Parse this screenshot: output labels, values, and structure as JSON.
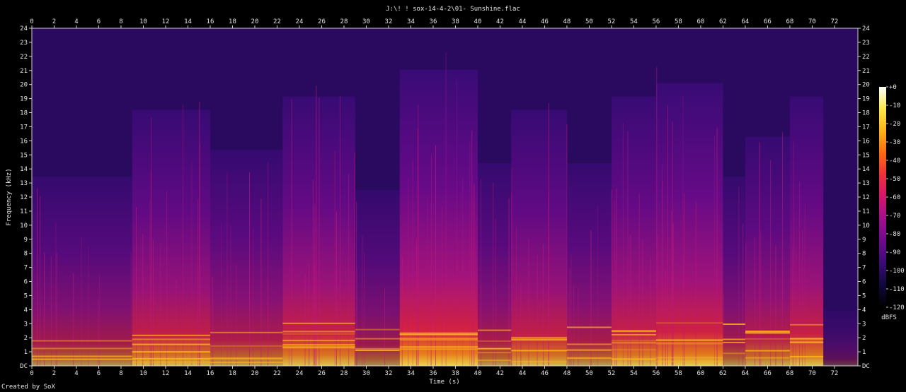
{
  "chart_data": {
    "type": "heatmap",
    "title": "J:\\! ! sox-14-4-2\\01- Sunshine.flac",
    "xlabel": "Time (s)",
    "ylabel": "Frequency (kHz)",
    "xlim": [
      0,
      74.1
    ],
    "ylim": [
      0,
      24
    ],
    "x_ticks": [
      "0",
      "2",
      "4",
      "6",
      "8",
      "10",
      "12",
      "14",
      "16",
      "18",
      "20",
      "22",
      "24",
      "26",
      "28",
      "30",
      "32",
      "34",
      "36",
      "38",
      "40",
      "42",
      "44",
      "46",
      "48",
      "50",
      "52",
      "54",
      "56",
      "58",
      "60",
      "62",
      "64",
      "66",
      "68",
      "70",
      "72"
    ],
    "y_ticks": [
      "DC",
      "1",
      "2",
      "3",
      "4",
      "5",
      "6",
      "7",
      "8",
      "9",
      "10",
      "11",
      "12",
      "13",
      "14",
      "15",
      "16",
      "17",
      "18",
      "19",
      "20",
      "21",
      "22",
      "23",
      "24"
    ],
    "colorbar": {
      "label": "dBFS",
      "ticks": [
        "+0",
        "-10",
        "-20",
        "-30",
        "-40",
        "-50",
        "-60",
        "-70",
        "-80",
        "-90",
        "-100",
        "-110",
        "-120"
      ],
      "range": [
        -120,
        0
      ],
      "colors": [
        "#000000",
        "#10083a",
        "#3a0b78",
        "#6e0a8c",
        "#a00f8e",
        "#d2166e",
        "#ef2f3b",
        "#fb6a10",
        "#fdb21a",
        "#fde84a",
        "#ffffff"
      ]
    },
    "segments_s": [
      [
        0,
        9,
        0.55
      ],
      [
        9,
        16,
        0.8
      ],
      [
        16,
        22.5,
        0.65
      ],
      [
        22.5,
        29,
        0.85
      ],
      [
        29,
        33,
        0.5
      ],
      [
        33,
        40,
        0.95
      ],
      [
        40,
        43,
        0.6
      ],
      [
        43,
        48,
        0.8
      ],
      [
        48,
        52,
        0.6
      ],
      [
        52,
        56,
        0.85
      ],
      [
        56,
        62,
        0.9
      ],
      [
        62,
        64,
        0.55
      ],
      [
        64,
        68,
        0.7
      ],
      [
        68,
        71,
        0.85
      ],
      [
        71,
        74.1,
        0.05
      ]
    ],
    "grid": false,
    "colorbar_placement": "right"
  },
  "credit": "Created by SoX"
}
